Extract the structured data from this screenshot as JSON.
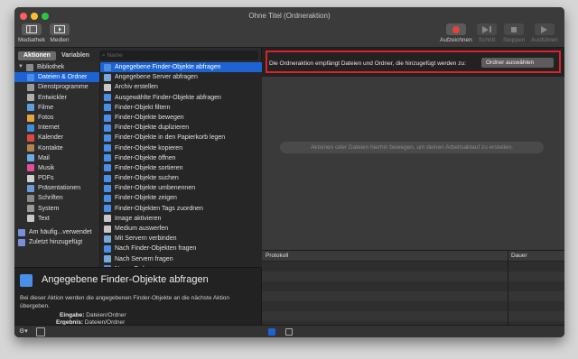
{
  "window": {
    "title": "Ohne Titel (Ordneraktion)"
  },
  "toolbar": {
    "left": [
      {
        "label": "Mediathek",
        "icon": "library-icon"
      },
      {
        "label": "Medien",
        "icon": "media-icon"
      }
    ],
    "record": "Aufzeichnen",
    "step": "Schritt",
    "stop": "Stoppen",
    "run": "Ausführen"
  },
  "tabs": {
    "actions": "Aktionen",
    "variables": "Variablen"
  },
  "search": {
    "placeholder": "Name"
  },
  "library": {
    "root": "Bibliothek",
    "items": [
      {
        "label": "Dateien & Ordner",
        "color": "#4a8fe7",
        "selected": true
      },
      {
        "label": "Dienstprogramme",
        "color": "#9a9a9a"
      },
      {
        "label": "Entwickler",
        "color": "#b0b0b0"
      },
      {
        "label": "Filme",
        "color": "#5aa0e0"
      },
      {
        "label": "Fotos",
        "color": "#e8a33c"
      },
      {
        "label": "Internet",
        "color": "#3f8fd8"
      },
      {
        "label": "Kalender",
        "color": "#e04a3c"
      },
      {
        "label": "Kontakte",
        "color": "#b08550"
      },
      {
        "label": "Mail",
        "color": "#6aaee8"
      },
      {
        "label": "Musik",
        "color": "#e0509a"
      },
      {
        "label": "PDFs",
        "color": "#d0d0d0"
      },
      {
        "label": "Präsentationen",
        "color": "#6a9ad8"
      },
      {
        "label": "Schriften",
        "color": "#8a8a8a"
      },
      {
        "label": "System",
        "color": "#999999"
      },
      {
        "label": "Text",
        "color": "#c8c8c8"
      }
    ],
    "smart": [
      {
        "label": "Am häufig...verwendet",
        "color": "#7a8fd8"
      },
      {
        "label": "Zuletzt hinzugefügt",
        "color": "#7a8fd8"
      }
    ]
  },
  "actions": [
    {
      "label": "Angegebene Finder-Objekte abfragen",
      "color": "#4a8fe7",
      "selected": true
    },
    {
      "label": "Angegebene Server abfragen",
      "color": "#7aa8d8"
    },
    {
      "label": "Archiv erstellen",
      "color": "#c8c8c8"
    },
    {
      "label": "Ausgewählte Finder-Objekte abfragen",
      "color": "#4a8fe7"
    },
    {
      "label": "Finder-Objekt filtern",
      "color": "#4a8fe7"
    },
    {
      "label": "Finder-Objekte bewegen",
      "color": "#4a8fe7"
    },
    {
      "label": "Finder-Objekte duplizieren",
      "color": "#4a8fe7"
    },
    {
      "label": "Finder-Objekte in den Papierkorb legen",
      "color": "#4a8fe7"
    },
    {
      "label": "Finder-Objekte kopieren",
      "color": "#4a8fe7"
    },
    {
      "label": "Finder-Objekte öffnen",
      "color": "#4a8fe7"
    },
    {
      "label": "Finder-Objekte sortieren",
      "color": "#4a8fe7"
    },
    {
      "label": "Finder-Objekte suchen",
      "color": "#4a8fe7"
    },
    {
      "label": "Finder-Objekte umbenennen",
      "color": "#4a8fe7"
    },
    {
      "label": "Finder-Objekte zeigen",
      "color": "#4a8fe7"
    },
    {
      "label": "Finder-Objekten Tags zuordnen",
      "color": "#4a8fe7"
    },
    {
      "label": "Image aktivieren",
      "color": "#c8c8c8"
    },
    {
      "label": "Medium auswerfen",
      "color": "#c8c8c8"
    },
    {
      "label": "Mit Servern verbinden",
      "color": "#7aa8d8"
    },
    {
      "label": "Nach Finder-Objekten fragen",
      "color": "#4a8fe7"
    },
    {
      "label": "Nach Servern fragen",
      "color": "#7aa8d8"
    },
    {
      "label": "Neuer Ordner",
      "color": "#4a8fe7"
    }
  ],
  "description": {
    "title": "Angegebene Finder-Objekte abfragen",
    "text": "Bei dieser Aktion werden die angegebenen Finder-Objekte an die nächste Aktion übergeben.",
    "input_label": "Eingabe:",
    "input_value": "Dateien/Ordner",
    "output_label": "Ergebnis:",
    "output_value": "Dateien/Ordner"
  },
  "workflow": {
    "banner_text": "Die Ordneraktion empfängt Dateien und Ordner, die hinzugefügt werden zu:",
    "popup_value": "Ordner auswählen",
    "drop_hint": "Aktionen oder Dateien hierhin bewegen, um deinen Arbeitsablauf zu erstellen."
  },
  "log": {
    "col1": "Protokoll",
    "col2": "Dauer"
  }
}
